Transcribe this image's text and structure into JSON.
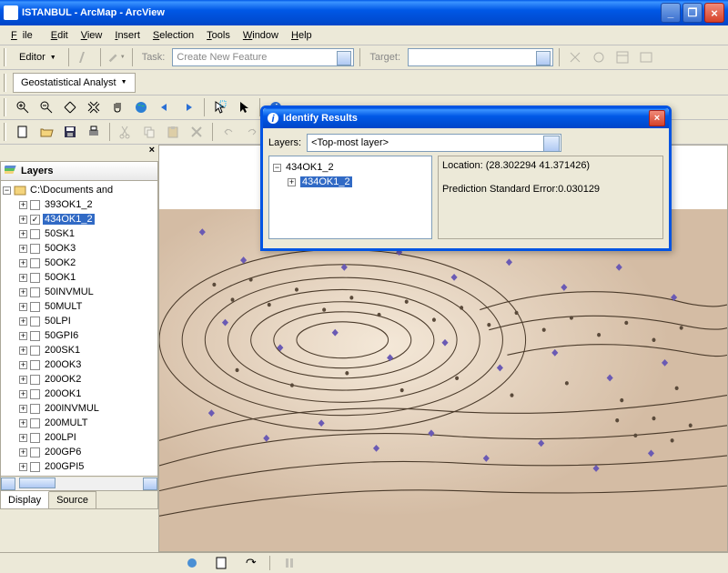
{
  "window": {
    "title": "ISTANBUL - ArcMap - ArcView"
  },
  "menubar": {
    "file": "File",
    "edit": "Edit",
    "view": "View",
    "insert": "Insert",
    "selection": "Selection",
    "tools": "Tools",
    "window": "Window",
    "help": "Help"
  },
  "toolbar1": {
    "editor": "Editor",
    "task": "Task:",
    "task_value": "Create New Feature",
    "target": "Target:"
  },
  "toolbar2": {
    "geostat": "Geostatistical Analyst"
  },
  "toc": {
    "header": "Layers",
    "root": "C:\\Documents and",
    "items": [
      "393OK1_2",
      "434OK1_2",
      "50SK1",
      "50OK3",
      "50OK2",
      "50OK1",
      "50INVMUL",
      "50MULT",
      "50LPI",
      "50GPI6",
      "200SK1",
      "200OK3",
      "200OK2",
      "200OK1",
      "200INVMUL",
      "200MULT",
      "200LPI",
      "200GP6",
      "200GPI5"
    ],
    "checked_index": 1,
    "selected_index": 1,
    "tab_display": "Display",
    "tab_source": "Source"
  },
  "identify": {
    "title": "Identify Results",
    "layers_label": "Layers:",
    "layers_value": "<Top-most layer>",
    "tree_parent": "434OK1_2",
    "tree_child": "434OK1_2",
    "location_label": "Location:",
    "location_value": "(28.302294 41.371426)",
    "prederr_label": "Prediction Standard Error:",
    "prederr_value": "0.030129"
  }
}
